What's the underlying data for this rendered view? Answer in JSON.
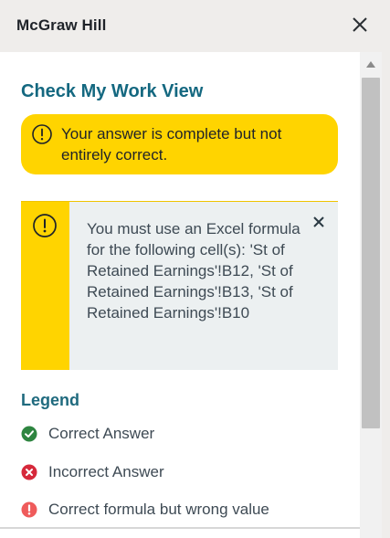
{
  "header": {
    "app_title": "McGraw Hill"
  },
  "panel": {
    "title": "Check My Work View",
    "result_banner": "Your answer is complete but not entirely correct.",
    "alert_message": "You must use an Excel formula for the following cell(s): 'St of Retained Earnings'!B12, 'St of Retained Earnings'!B13, 'St of Retained Earnings'!B10"
  },
  "legend": {
    "title": "Legend",
    "items": [
      {
        "label": "Correct Answer",
        "icon": "check-circle-icon",
        "color": "#2e8540"
      },
      {
        "label": "Incorrect Answer",
        "icon": "x-circle-icon",
        "color": "#d6293b"
      },
      {
        "label": "Correct formula but wrong value",
        "icon": "exclamation-circle-icon",
        "color": "#ef5b5b"
      }
    ]
  },
  "colors": {
    "accent_title": "#146880",
    "warning_yellow": "#ffd400",
    "alert_bg": "#ecf0f1"
  }
}
